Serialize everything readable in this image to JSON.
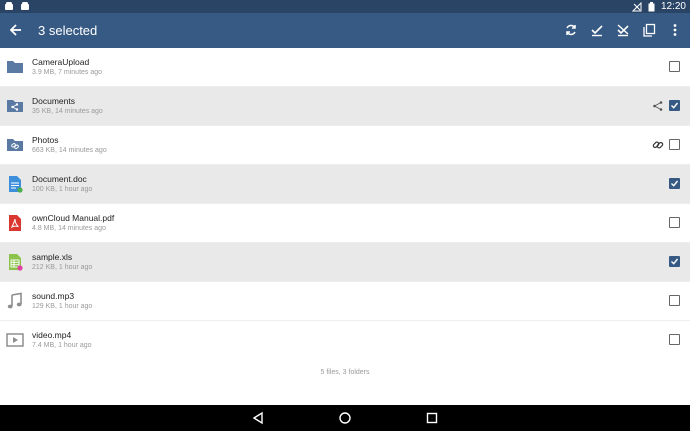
{
  "status_bar": {
    "time": "12:20"
  },
  "app_bar": {
    "title": "3 selected",
    "actions": [
      "sync-icon",
      "select-all-icon",
      "deselect-icon",
      "copy-icon",
      "more-icon"
    ]
  },
  "files": [
    {
      "name": "CameraUpload",
      "meta": "3.9 MB, 7 minutes ago",
      "icon": "folder-icon",
      "selected": false,
      "share": ""
    },
    {
      "name": "Documents",
      "meta": "35 KB, 14 minutes ago",
      "icon": "shared-folder-icon",
      "selected": true,
      "share": "share-icon"
    },
    {
      "name": "Photos",
      "meta": "663 KB, 14 minutes ago",
      "icon": "link-folder-icon",
      "selected": false,
      "share": "link-icon"
    },
    {
      "name": "Document.doc",
      "meta": "100 KB, 1 hour ago",
      "icon": "doc-icon",
      "selected": true,
      "share": ""
    },
    {
      "name": "ownCloud Manual.pdf",
      "meta": "4.8 MB, 14 minutes ago",
      "icon": "pdf-icon",
      "selected": false,
      "share": ""
    },
    {
      "name": "sample.xls",
      "meta": "212 KB, 1 hour ago",
      "icon": "xls-icon",
      "selected": true,
      "share": ""
    },
    {
      "name": "sound.mp3",
      "meta": "129 KB, 1 hour ago",
      "icon": "audio-icon",
      "selected": false,
      "share": ""
    },
    {
      "name": "video.mp4",
      "meta": "7.4 MB, 1 hour ago",
      "icon": "video-icon",
      "selected": false,
      "share": ""
    }
  ],
  "footer": "5 files, 3 folders",
  "colors": {
    "appbar": "#375a84",
    "statusbar": "#2a4466",
    "folder": "#5a7aa3"
  }
}
